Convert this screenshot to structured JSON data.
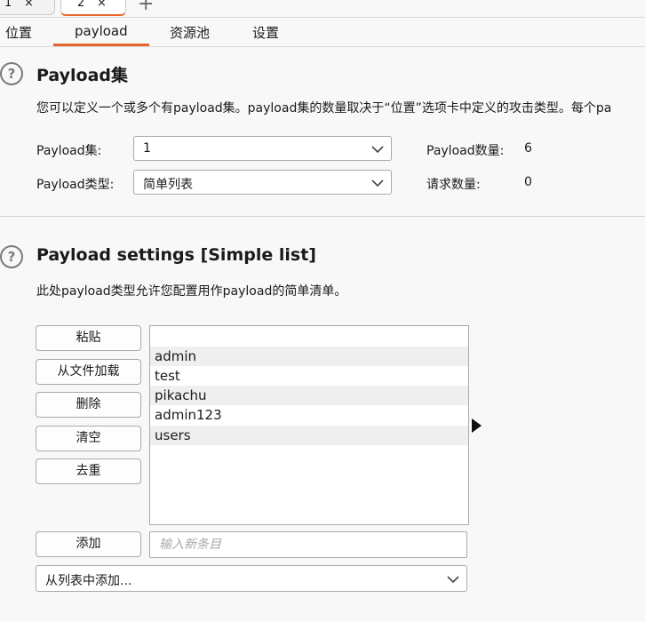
{
  "top_tabs": [
    {
      "label": "1",
      "close": "×"
    },
    {
      "label": "2",
      "close": "×"
    }
  ],
  "new_tab_symbol": "+",
  "sub_tabs": [
    "位置",
    "payload",
    "资源池",
    "设置"
  ],
  "payload_sets": {
    "title": "Payload集",
    "description": "您可以定义一个或多个有payload集。payload集的数量取决于“位置”选项卡中定义的攻击类型。每个pa",
    "set_label": "Payload集:",
    "set_value": "1",
    "type_label": "Payload类型:",
    "type_value": "简单列表",
    "count_label": "Payload数量:",
    "count_value": "6",
    "requests_label": "请求数量:",
    "requests_value": "0"
  },
  "payload_settings": {
    "title": "Payload settings [Simple list]",
    "description": "此处payload类型允许您配置用作payload的简单清单。",
    "buttons": {
      "paste": "粘贴",
      "load": "从文件加载",
      "remove": "删除",
      "clear": "清空",
      "dedupe": "去重",
      "add": "添加"
    },
    "list_items": [
      "",
      "admin",
      "test",
      "pikachu",
      "admin123",
      "users"
    ],
    "new_item_placeholder": "输入新条目",
    "add_from_list": "从列表中添加..."
  },
  "help_symbol": "?",
  "colors": {
    "accent": "#e8672a"
  }
}
